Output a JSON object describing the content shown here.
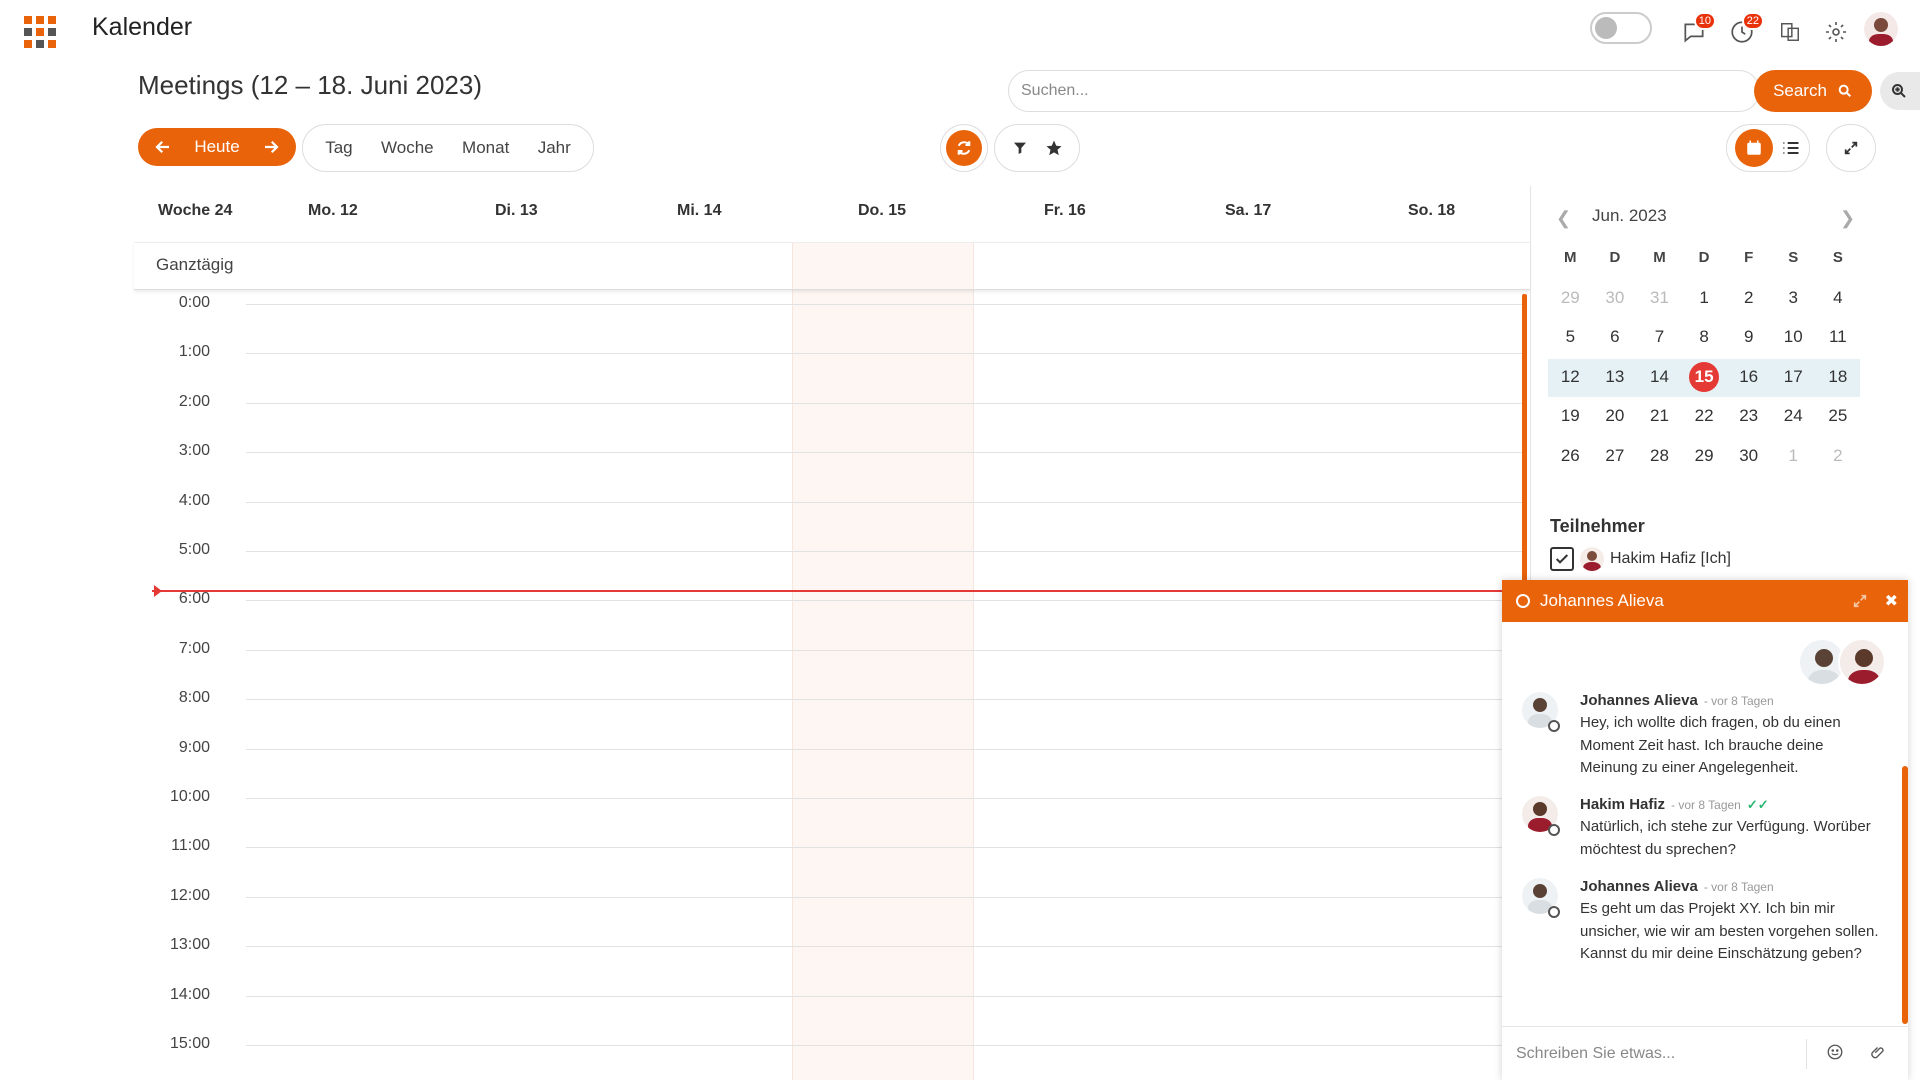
{
  "app": {
    "title": "Kalender"
  },
  "header": {
    "chat_badge": "10",
    "activity_badge": "22"
  },
  "page": {
    "title": "Meetings (12 – 18. Juni 2023)"
  },
  "search": {
    "placeholder": "Suchen...",
    "value": "",
    "button_label": "Search"
  },
  "toolbar": {
    "today_label": "Heute",
    "views": [
      "Tag",
      "Woche",
      "Monat",
      "Jahr"
    ]
  },
  "week": {
    "week_label": "Woche 24",
    "days": [
      "Mo. 12",
      "Di. 13",
      "Mi. 14",
      "Do. 15",
      "Fr. 16",
      "Sa. 17",
      "So. 18"
    ],
    "allday_label": "Ganztägig",
    "hours": [
      "0:00",
      "1:00",
      "2:00",
      "3:00",
      "4:00",
      "5:00",
      "6:00",
      "7:00",
      "8:00",
      "9:00",
      "10:00",
      "11:00",
      "12:00",
      "13:00",
      "14:00",
      "15:00"
    ]
  },
  "mini_calendar": {
    "month_label": "Jun. 2023",
    "weekdays": [
      "M",
      "D",
      "M",
      "D",
      "F",
      "S",
      "S"
    ],
    "weeks": [
      [
        "29",
        "30",
        "31",
        "1",
        "2",
        "3",
        "4"
      ],
      [
        "5",
        "6",
        "7",
        "8",
        "9",
        "10",
        "11"
      ],
      [
        "12",
        "13",
        "14",
        "15",
        "16",
        "17",
        "18"
      ],
      [
        "19",
        "20",
        "21",
        "22",
        "23",
        "24",
        "25"
      ],
      [
        "26",
        "27",
        "28",
        "29",
        "30",
        "1",
        "2"
      ]
    ],
    "today": "15"
  },
  "participants": {
    "title": "Teilnehmer",
    "items": [
      {
        "name": "Hakim Hafiz [Ich]",
        "checked": true
      }
    ]
  },
  "chat": {
    "title": "Johannes Alieva",
    "messages": [
      {
        "author": "Johannes Alieva",
        "time": "- vor 8 Tagen",
        "text": "Hey, ich wollte dich fragen, ob du einen Moment Zeit hast. Ich brauche deine Meinung zu einer Angelegenheit."
      },
      {
        "author": "Hakim Hafiz",
        "time": "- vor 8 Tagen",
        "text": "Natürlich, ich stehe zur Verfügung. Worüber möchtest du sprechen?"
      },
      {
        "author": "Johannes Alieva",
        "time": "- vor 8 Tagen",
        "text": "Es geht um das Projekt XY. Ich bin mir unsicher, wie wir am besten vorgehen sollen. Kannst du mir deine Einschätzung geben?"
      }
    ],
    "input_placeholder": "Schreiben Sie etwas..."
  },
  "colors": {
    "accent": "#e8630a",
    "now_line": "#e53935",
    "today_bg": "#fdf6f2"
  }
}
